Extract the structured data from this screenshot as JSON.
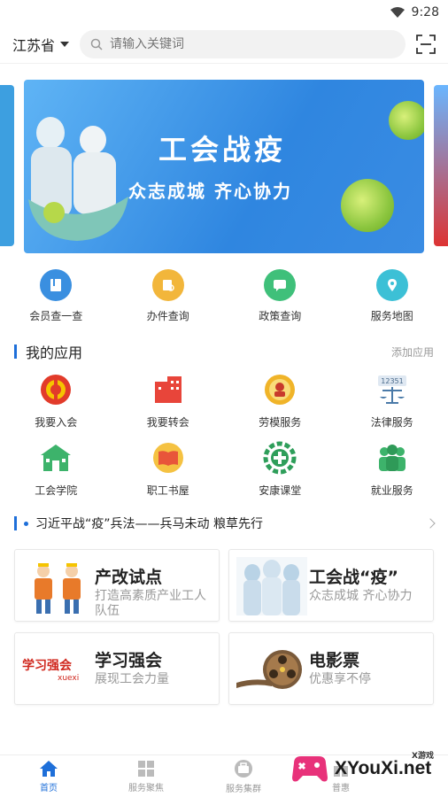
{
  "status": {
    "time": "9:28"
  },
  "top": {
    "province": "江苏省",
    "search_placeholder": "请输入关键词"
  },
  "banner": {
    "title": "工会战疫",
    "subtitle": "众志成城  齐心协力"
  },
  "quick": [
    {
      "label": "会员查一查",
      "color": "#3a8fe0"
    },
    {
      "label": "办件查询",
      "color": "#f2b63b"
    },
    {
      "label": "政策查询",
      "color": "#3fc07a"
    },
    {
      "label": "服务地图",
      "color": "#3cc0d6"
    }
  ],
  "apps_section": {
    "title": "我的应用",
    "more": "添加应用"
  },
  "apps": [
    {
      "label": "我要入会",
      "icon": "union-emblem-icon"
    },
    {
      "label": "我要转会",
      "icon": "building-transfer-icon"
    },
    {
      "label": "劳模服务",
      "icon": "model-worker-medal-icon"
    },
    {
      "label": "法律服务",
      "icon": "legal-scales-icon"
    },
    {
      "label": "工会学院",
      "icon": "academy-building-icon"
    },
    {
      "label": "职工书屋",
      "icon": "book-icon"
    },
    {
      "label": "安康课堂",
      "icon": "health-cross-gear-icon"
    },
    {
      "label": "就业服务",
      "icon": "people-group-icon"
    }
  ],
  "news": {
    "text": "习近平战“疫”兵法——兵马未动 粮草先行"
  },
  "cards": [
    {
      "title": "产改试点",
      "sub": "打造高素质产业工人队伍"
    },
    {
      "title": "工会战“疫”",
      "sub": "众志成城  齐心协力"
    },
    {
      "title": "学习强会",
      "sub": "展现工会力量",
      "logo": "学习强会",
      "logo_sub": "xuexi"
    },
    {
      "title": "电影票",
      "sub": "优惠享不停"
    }
  ],
  "tabs": [
    {
      "label": "首页",
      "active": true
    },
    {
      "label": "服务聚焦"
    },
    {
      "label": "服务集群"
    },
    {
      "label": "普惠"
    }
  ],
  "watermark": {
    "main": "XYouXi.net",
    "small": "X游戏"
  },
  "colors": {
    "accent": "#1e6fd9",
    "banner": "#3a8ce3"
  }
}
